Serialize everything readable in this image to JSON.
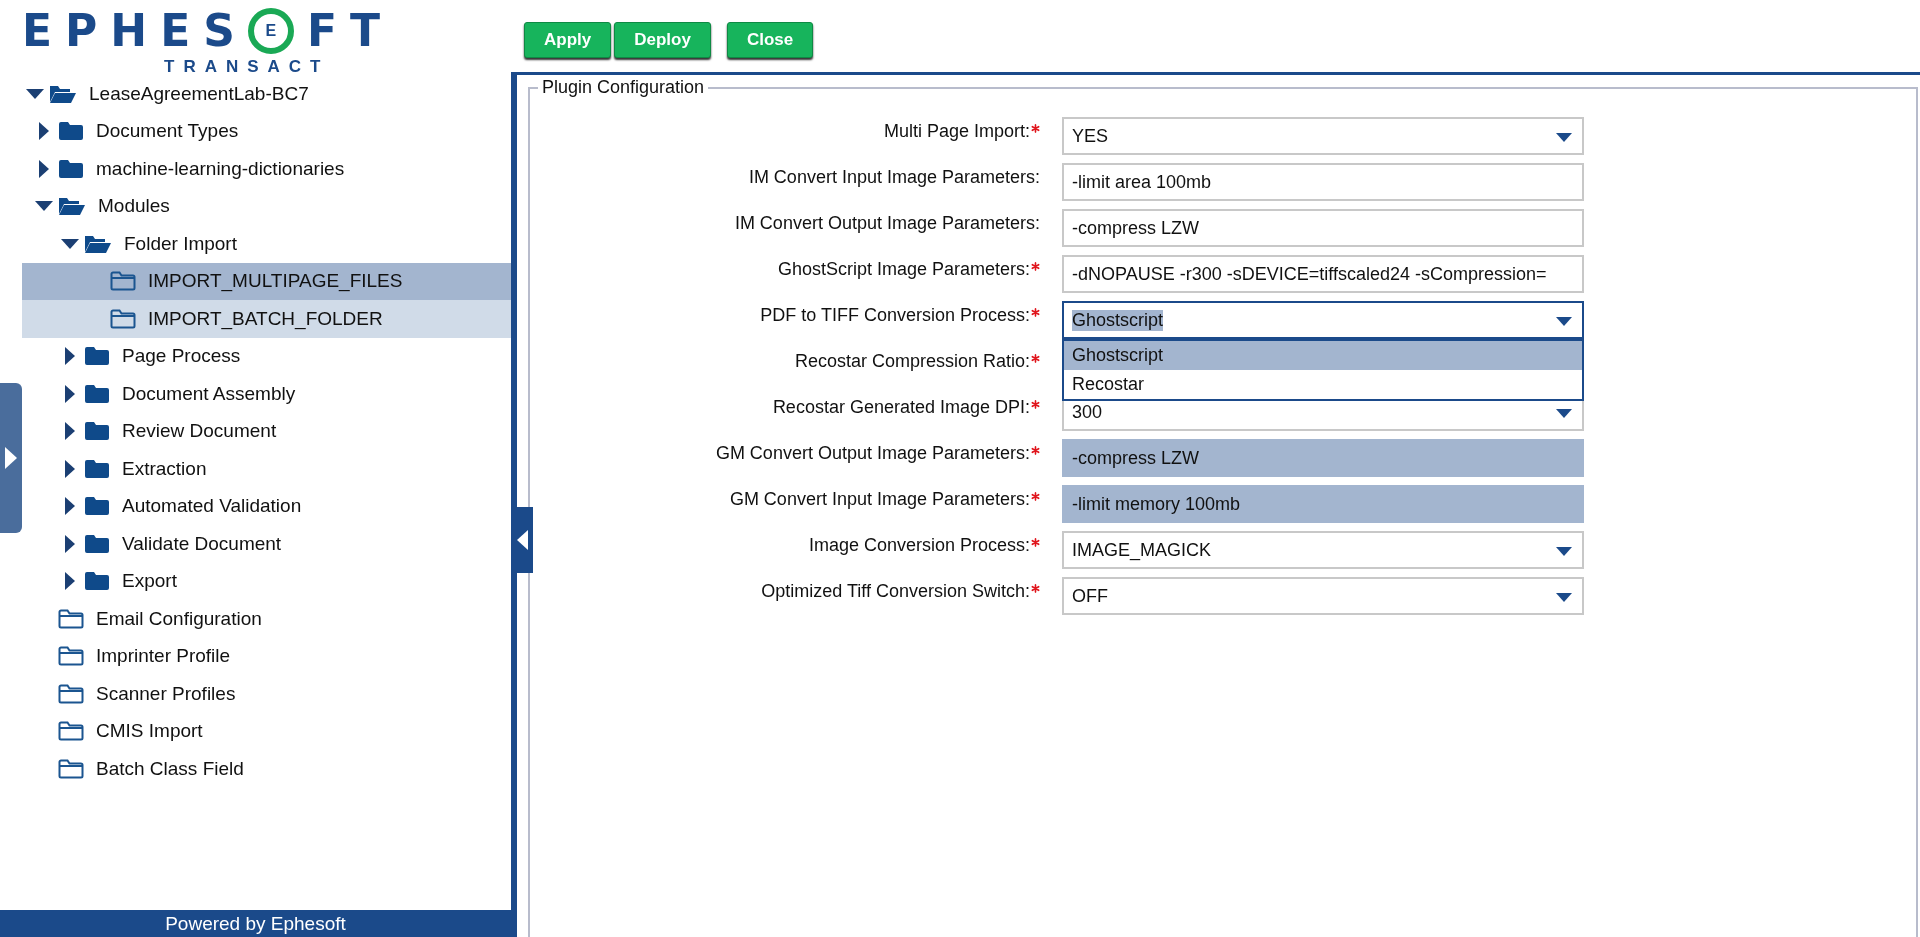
{
  "logo": {
    "letters": "EPHES",
    "mark": "E",
    "letters_end": "FT",
    "tagline": "TRANSACT"
  },
  "toolbar": {
    "buttons": [
      "Apply",
      "Deploy",
      "Close"
    ]
  },
  "tree": [
    {
      "label": "LeaseAgreementLab-BC7",
      "kind": "branch",
      "expanded": true,
      "selected": false,
      "hovered": false,
      "children": [
        {
          "label": "Document Types",
          "kind": "branch",
          "expanded": false,
          "selected": false,
          "hovered": false
        },
        {
          "label": "machine-learning-dictionaries",
          "kind": "branch",
          "expanded": false,
          "selected": false,
          "hovered": false
        },
        {
          "label": "Modules",
          "kind": "branch",
          "expanded": true,
          "selected": false,
          "hovered": false,
          "children": [
            {
              "label": "Folder Import",
              "kind": "branch",
              "expanded": true,
              "selected": false,
              "hovered": false,
              "children": [
                {
                  "label": "IMPORT_MULTIPAGE_FILES",
                  "kind": "leaf",
                  "selected": true,
                  "hovered": false
                },
                {
                  "label": "IMPORT_BATCH_FOLDER",
                  "kind": "leaf",
                  "selected": false,
                  "hovered": true
                }
              ]
            },
            {
              "label": "Page Process",
              "kind": "branch",
              "expanded": false,
              "selected": false,
              "hovered": false
            },
            {
              "label": "Document Assembly",
              "kind": "branch",
              "expanded": false,
              "selected": false,
              "hovered": false
            },
            {
              "label": "Review Document",
              "kind": "branch",
              "expanded": false,
              "selected": false,
              "hovered": false
            },
            {
              "label": "Extraction",
              "kind": "branch",
              "expanded": false,
              "selected": false,
              "hovered": false
            },
            {
              "label": "Automated Validation",
              "kind": "branch",
              "expanded": false,
              "selected": false,
              "hovered": false
            },
            {
              "label": "Validate Document",
              "kind": "branch",
              "expanded": false,
              "selected": false,
              "hovered": false
            },
            {
              "label": "Export",
              "kind": "branch",
              "expanded": false,
              "selected": false,
              "hovered": false
            }
          ]
        },
        {
          "label": "Email Configuration",
          "kind": "leaf",
          "selected": false,
          "hovered": false
        },
        {
          "label": "Imprinter Profile",
          "kind": "leaf",
          "selected": false,
          "hovered": false
        },
        {
          "label": "Scanner Profiles",
          "kind": "leaf",
          "selected": false,
          "hovered": false
        },
        {
          "label": "CMIS Import",
          "kind": "leaf",
          "selected": false,
          "hovered": false
        },
        {
          "label": "Batch Class Field",
          "kind": "leaf",
          "selected": false,
          "hovered": false
        }
      ]
    }
  ],
  "footer": "Powered by Ephesoft",
  "form": {
    "legend": "Plugin Configuration",
    "fields": [
      {
        "label": "Multi Page Import:",
        "required": true,
        "kind": "select",
        "value": "YES",
        "disabled": false,
        "open": false
      },
      {
        "label": "IM Convert Input Image Parameters:",
        "required": false,
        "kind": "text",
        "value": "-limit area 100mb",
        "disabled": false
      },
      {
        "label": "IM Convert Output Image Parameters:",
        "required": false,
        "kind": "text",
        "value": "-compress LZW",
        "disabled": false
      },
      {
        "label": "GhostScript Image Parameters:",
        "required": true,
        "kind": "text",
        "value": "-dNOPAUSE -r300 -sDEVICE=tiffscaled24 -sCompression=",
        "disabled": false
      },
      {
        "label": "PDF to TIFF Conversion Process:",
        "required": true,
        "kind": "select",
        "value": "Ghostscript",
        "disabled": false,
        "open": true,
        "options": [
          {
            "label": "Ghostscript",
            "selected": true
          },
          {
            "label": "Recostar",
            "selected": false
          }
        ]
      },
      {
        "label": "Recostar Compression Ratio:",
        "required": true,
        "kind": "covered"
      },
      {
        "label": "Recostar Generated Image DPI:",
        "required": true,
        "kind": "select",
        "value": "300",
        "disabled": false,
        "open": false
      },
      {
        "label": "GM Convert Output Image Parameters:",
        "required": true,
        "kind": "text",
        "value": "-compress LZW",
        "disabled": true
      },
      {
        "label": "GM Convert Input Image Parameters:",
        "required": true,
        "kind": "text",
        "value": "-limit memory 100mb",
        "disabled": true
      },
      {
        "label": "Image Conversion Process:",
        "required": true,
        "kind": "select",
        "value": "IMAGE_MAGICK",
        "disabled": false,
        "open": false
      },
      {
        "label": "Optimized Tiff Conversion Switch:",
        "required": true,
        "kind": "select",
        "value": "OFF",
        "disabled": false,
        "open": false
      }
    ]
  }
}
